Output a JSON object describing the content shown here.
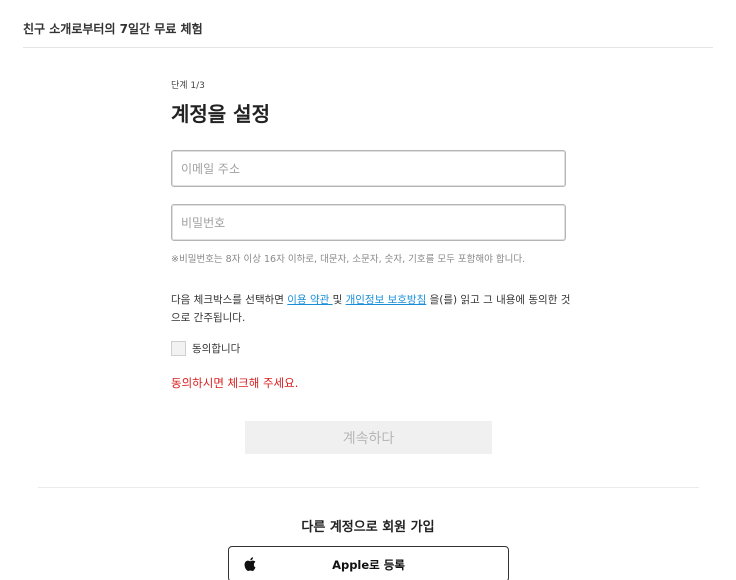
{
  "header": {
    "title": "친구 소개로부터의 7일간 무료 체험"
  },
  "form": {
    "step": "단계 1/3",
    "title": "계정을 설정",
    "email_placeholder": "이메일 주소",
    "password_placeholder": "비밀번호",
    "password_hint": "※비밀번호는 8자 이상 16자 이하로, 대문자, 소문자, 숫자, 기호를 모두 포함해야 합니다.",
    "agreement": {
      "prefix": "다음 체크박스를 선택하면 ",
      "terms_link": "이용 약관 ",
      "middle": "및 ",
      "privacy_link": "개인정보 보호방침",
      "suffix": " 을(를) 읽고 그 내용에 동의한 것으로 간주됩니다."
    },
    "checkbox_label": "동의합니다",
    "checkbox_checked": false,
    "error": "동의하시면 체크해 주세요.",
    "continue_label": "계속하다"
  },
  "alt_signup": {
    "title": "다른 계정으로 회원 가입",
    "apple_label": "Apple로 등록",
    "apple_icon": "apple-logo-icon"
  }
}
